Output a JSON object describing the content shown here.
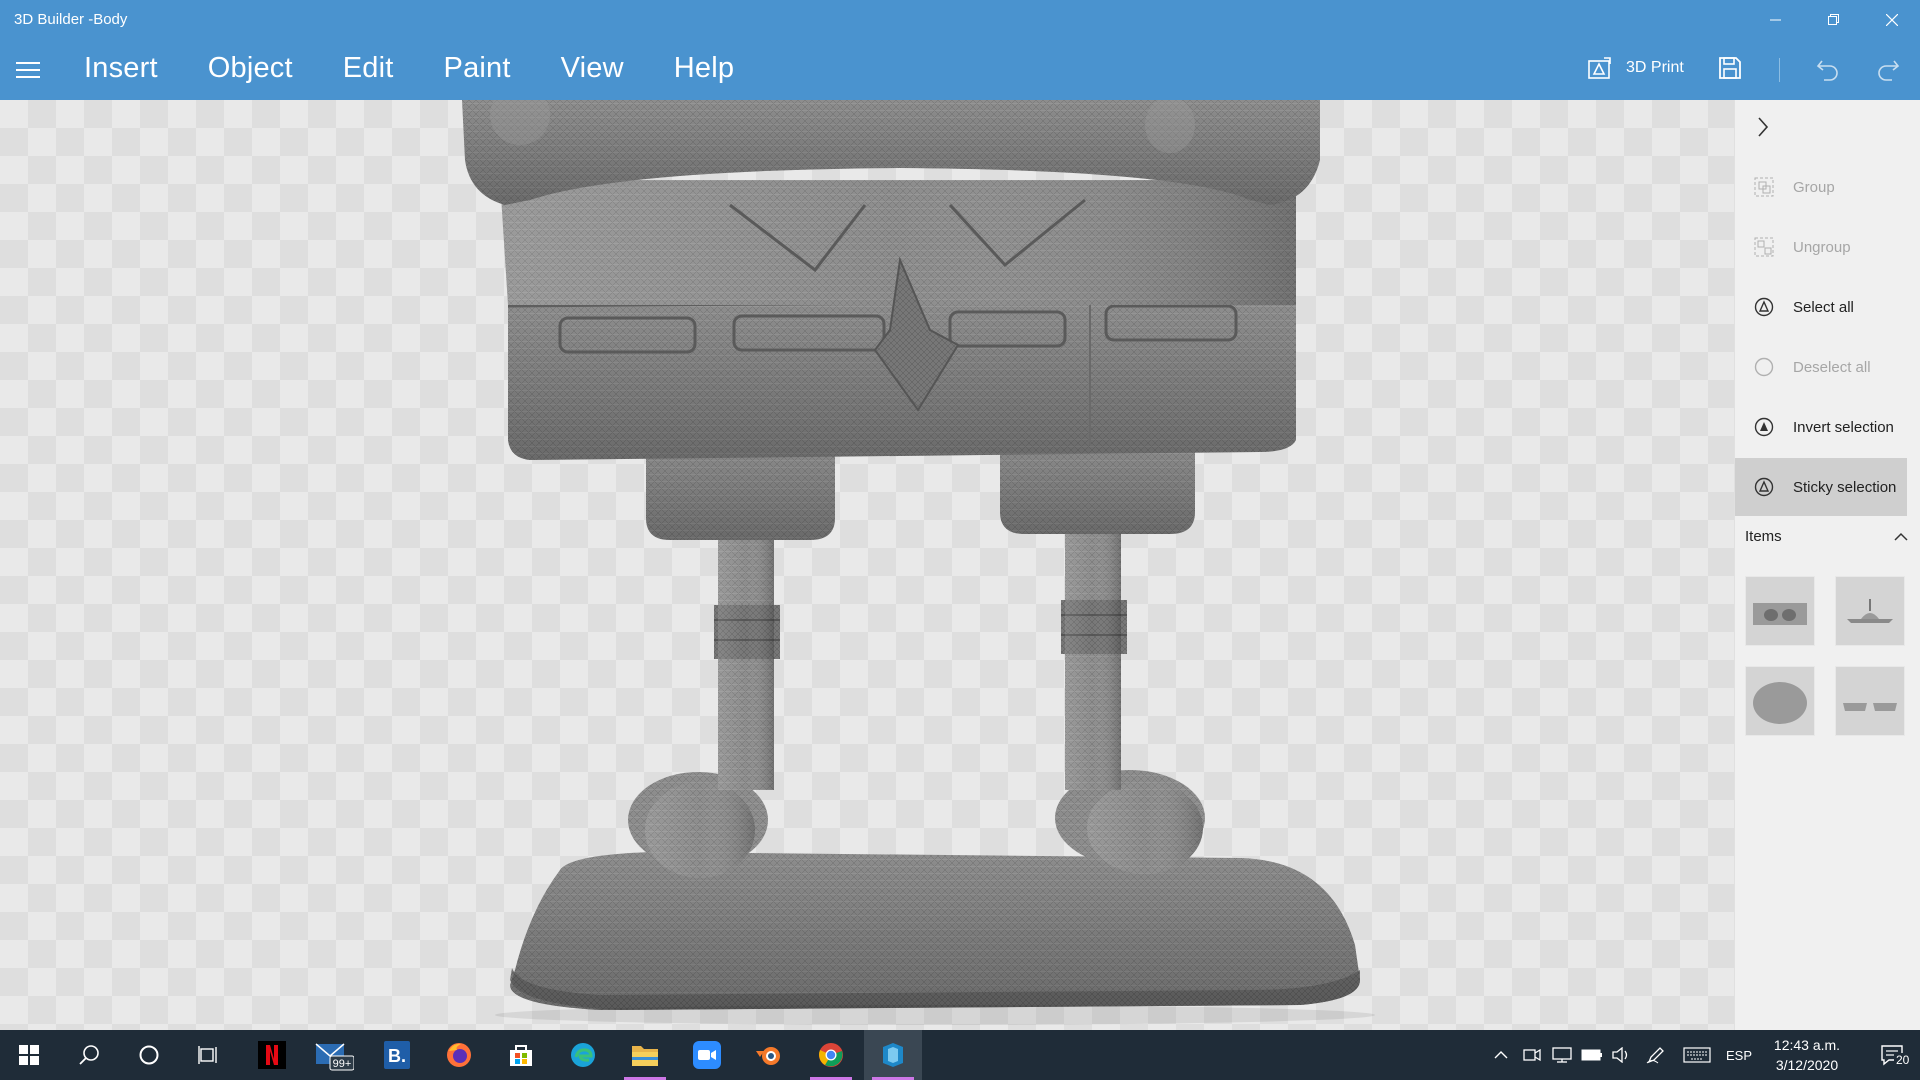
{
  "window": {
    "title": "3D Builder -Body",
    "minimize_icon": "minimize-icon",
    "restore_icon": "restore-icon",
    "close_icon": "close-icon"
  },
  "menubar": {
    "items": [
      "Insert",
      "Object",
      "Edit",
      "Paint",
      "View",
      "Help"
    ],
    "print_label": "3D Print"
  },
  "panel": {
    "commands": [
      {
        "label": "Group",
        "icon": "group-icon",
        "enabled": false,
        "active": false
      },
      {
        "label": "Ungroup",
        "icon": "ungroup-icon",
        "enabled": false,
        "active": false
      },
      {
        "label": "Select all",
        "icon": "select-all-icon",
        "enabled": true,
        "active": false
      },
      {
        "label": "Deselect all",
        "icon": "deselect-all-icon",
        "enabled": false,
        "active": false
      },
      {
        "label": "Invert selection",
        "icon": "invert-selection-icon",
        "enabled": true,
        "active": false
      },
      {
        "label": "Sticky selection",
        "icon": "sticky-selection-icon",
        "enabled": true,
        "active": true
      }
    ],
    "items_header": "Items",
    "items": [
      "item-thumbnail-1",
      "item-thumbnail-2",
      "item-thumbnail-3",
      "item-thumbnail-4"
    ]
  },
  "taskbar": {
    "apps": [
      {
        "name": "netflix",
        "running": false
      },
      {
        "name": "mail",
        "badge": "99+",
        "running": false
      },
      {
        "name": "bing",
        "running": false
      },
      {
        "name": "firefox",
        "running": false
      },
      {
        "name": "store",
        "running": false
      },
      {
        "name": "edge",
        "running": false
      },
      {
        "name": "file-explorer",
        "running": true
      },
      {
        "name": "zoom",
        "running": false
      },
      {
        "name": "blender",
        "running": false
      },
      {
        "name": "chrome",
        "running": true
      },
      {
        "name": "3d-builder",
        "running": true
      }
    ],
    "language": "ESP",
    "time": "12:43 a.m.",
    "date": "3/12/2020",
    "notifications": "20"
  },
  "colors": {
    "titlebar": "#4a93cf",
    "panel": "#f0f0f0",
    "panel_active": "#cfcfcf",
    "taskbar": "#1f2c38",
    "model": "#8a8a8a"
  }
}
